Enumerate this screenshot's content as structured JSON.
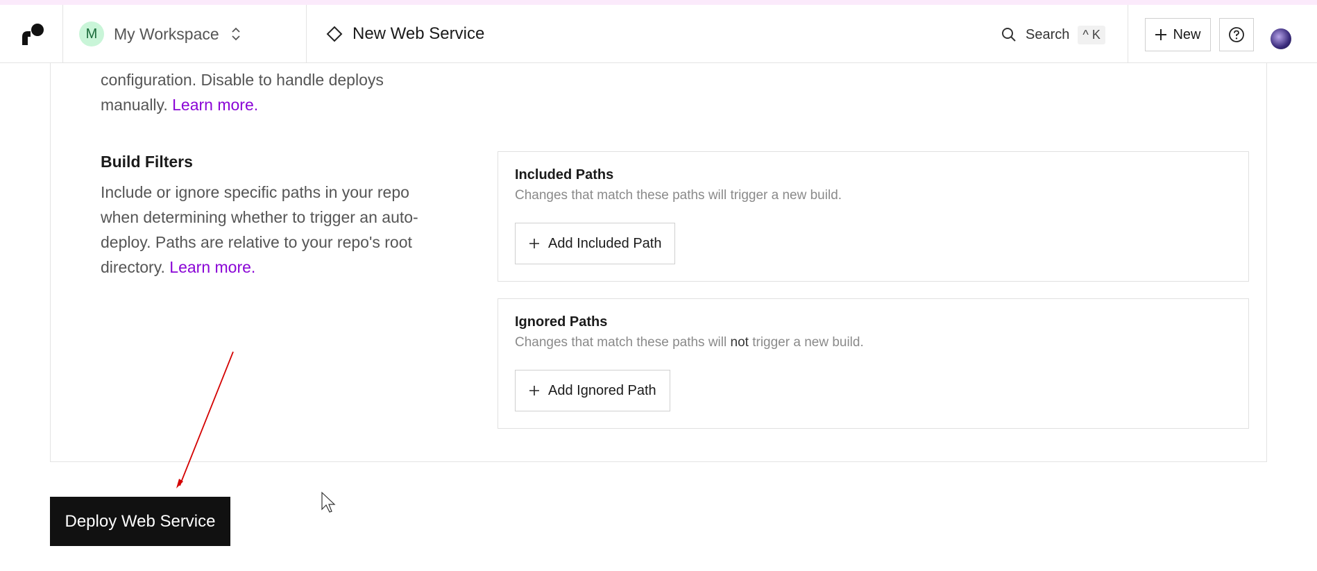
{
  "header": {
    "workspace": {
      "initial": "M",
      "name": "My Workspace"
    },
    "breadcrumb": {
      "title": "New Web Service"
    },
    "search": {
      "label": "Search",
      "shortcut": "^ K"
    },
    "new_label": "New"
  },
  "auto_deploy": {
    "line1": "configuration. Disable to handle deploys",
    "line2": "manually.",
    "link": "Learn more."
  },
  "build_filters": {
    "title": "Build Filters",
    "desc": [
      "Include or ignore specific paths in your repo",
      "when determining whether to trigger an auto-",
      "deploy. Paths are relative to your repo's root",
      "directory."
    ],
    "link": "Learn more.",
    "included": {
      "title": "Included Paths",
      "desc": "Changes that match these paths will trigger a new build.",
      "button": "Add Included Path"
    },
    "ignored": {
      "title": "Ignored Paths",
      "desc_before": "Changes that match these paths will ",
      "desc_strong": "not",
      "desc_after": " trigger a new build.",
      "button": "Add Ignored Path"
    }
  },
  "deploy_button": "Deploy Web Service",
  "colors": {
    "link": "#8a05d6",
    "deploy_bg": "#111111",
    "annotation_arrow": "#d40000"
  }
}
